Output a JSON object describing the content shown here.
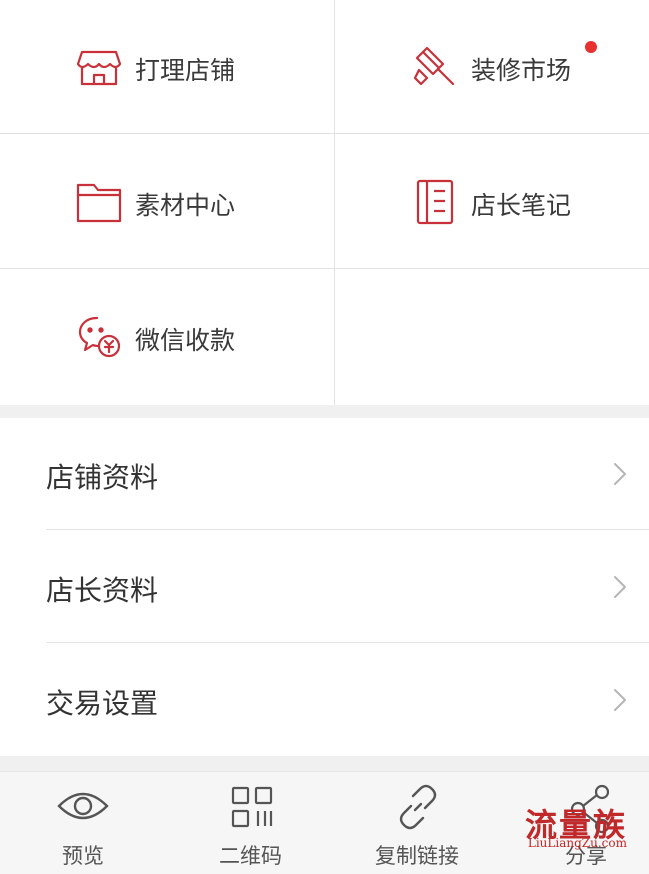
{
  "grid": {
    "items": [
      {
        "label": "打理店铺",
        "icon": "storefront-icon"
      },
      {
        "label": "装修市场",
        "icon": "paint-roller-icon",
        "badge": true
      },
      {
        "label": "素材中心",
        "icon": "folder-icon"
      },
      {
        "label": "店长笔记",
        "icon": "notebook-icon"
      },
      {
        "label": "微信收款",
        "icon": "wechat-pay-icon"
      }
    ]
  },
  "menu": {
    "items": [
      {
        "label": "店铺资料"
      },
      {
        "label": "店长资料"
      },
      {
        "label": "交易设置"
      }
    ]
  },
  "tabbar": {
    "items": [
      {
        "label": "预览",
        "icon": "eye-icon"
      },
      {
        "label": "二维码",
        "icon": "qrcode-icon"
      },
      {
        "label": "复制链接",
        "icon": "link-icon"
      },
      {
        "label": "分享",
        "icon": "share-icon"
      }
    ]
  },
  "watermark": {
    "text": "流量族",
    "sub": "LiuLiangZu.com"
  },
  "colors": {
    "accent": "#c8313a",
    "badge": "#e8312f",
    "divider": "#e2e2e2",
    "section_gap": "#f0f0f0"
  }
}
